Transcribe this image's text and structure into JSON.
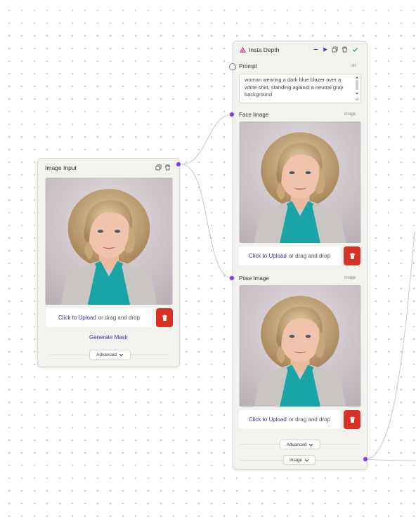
{
  "image_input_node": {
    "title": "Image Input",
    "upload": {
      "link": "Click to Upload",
      "rest": "or drag and drop"
    },
    "generate_mask": "Generate Mask",
    "advanced": "Advanced"
  },
  "insta_depth_node": {
    "title": "Insta Depth",
    "prompt": {
      "label": "Prompt",
      "type": "str",
      "value": "woman wearing a dark blue blazer over a white shirt, standing against a neutral gray background"
    },
    "face_image": {
      "label": "Face Image",
      "type": "image",
      "upload_link": "Click to Upload",
      "upload_rest": "or drag and drop"
    },
    "pose_image": {
      "label": "Pose Image",
      "type": "image",
      "upload_link": "Click to Upload",
      "upload_rest": "or drag and drop"
    },
    "advanced": "Advanced",
    "output": "Image"
  },
  "icons": [
    "copy-icon",
    "trash-icon",
    "minimize-icon",
    "play-icon",
    "check-icon",
    "chevron-down-icon",
    "node-logo-icon"
  ],
  "colors": {
    "accent": "#7d3ed6",
    "link": "#4b2ca3",
    "danger": "#d83227",
    "node_bg": "#f2f2ee"
  }
}
